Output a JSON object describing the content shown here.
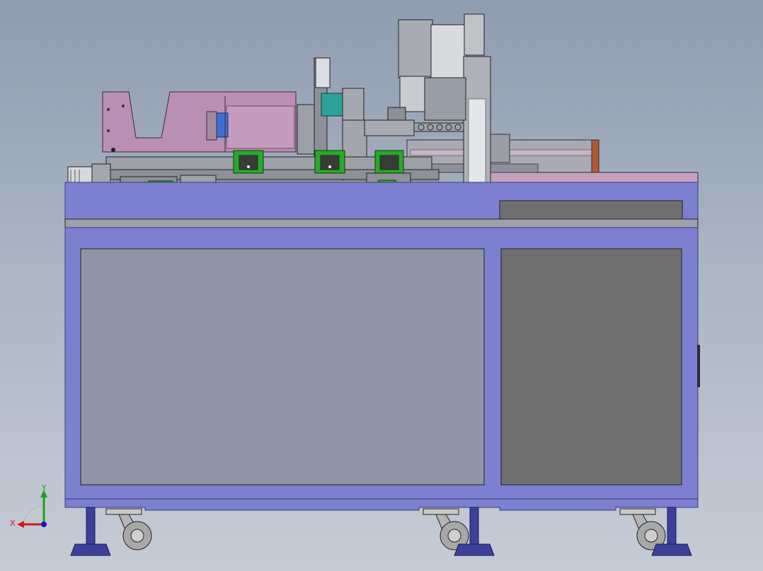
{
  "viewport": {
    "background_top": "#8f9db0",
    "background_bottom": "#c6ccd6"
  },
  "colors": {
    "frame_blue": "#7d7fd1",
    "frame_outline": "#3a3c6e",
    "panel_grey": "#8f94a6",
    "panel_dark": "#6f6f70",
    "hopper_pink": "#b98fb3",
    "top_plate_pink": "#c7a0bf",
    "module_green": "#2aa82a",
    "sensor_teal": "#2aa39a",
    "machine_grey": "#9a9da3",
    "dark_steel": "#4a4c52",
    "caster_grey": "#a8a8a8",
    "foot_blue": "#3d3f9c",
    "axis_x": "#d11919",
    "axis_y": "#19a319",
    "axis_z": "#1919d1"
  },
  "triad": {
    "x_label": "X",
    "y_label": "Y"
  },
  "icons": [
    "coordinate-triad-icon",
    "caster-wheel-icon",
    "leveling-foot-icon"
  ]
}
